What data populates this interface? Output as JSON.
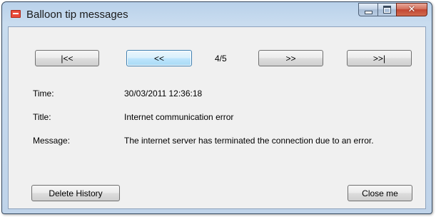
{
  "window": {
    "title": "Balloon tip messages",
    "minimize_icon": "minimize-icon",
    "maximize_icon": "maximize-icon",
    "close_icon": "close-icon",
    "close_glyph": "✕"
  },
  "navigation": {
    "first_label": "|<<",
    "prev_label": "<<",
    "position": "4/5",
    "next_label": ">>",
    "last_label": ">>|"
  },
  "details": {
    "time_label": "Time:",
    "time_value": "30/03/2011 12:36:18",
    "title_label": "Title:",
    "title_value": "Internet communication error",
    "message_label": "Message:",
    "message_value": "The internet server has terminated the connection due to an error."
  },
  "actions": {
    "delete_label": "Delete History",
    "close_label": "Close me"
  },
  "colors": {
    "accent_close": "#c24632",
    "focus_border": "#3c7fb1"
  }
}
